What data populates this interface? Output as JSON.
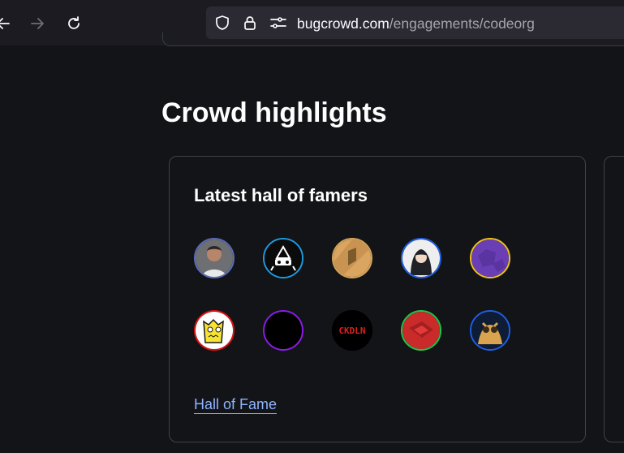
{
  "browser": {
    "url_domain": "bugcrowd.com",
    "url_path": "/engagements/codeorg",
    "icons": [
      "back-arrow-icon",
      "forward-arrow-icon",
      "reload-icon",
      "shield-icon",
      "lock-icon",
      "permissions-icon"
    ]
  },
  "section": {
    "title": "Crowd highlights"
  },
  "hall_of_fame_card": {
    "title": "Latest hall of famers",
    "link_label": "Hall of Fame",
    "avatars": [
      {
        "name": "avatar-1",
        "ring_color": "#5b6bb8"
      },
      {
        "name": "avatar-2",
        "ring_color": "#1e9be0"
      },
      {
        "name": "avatar-3",
        "ring_color": "#d4a35a"
      },
      {
        "name": "avatar-4",
        "ring_color": "#1f5fe0"
      },
      {
        "name": "avatar-5",
        "ring_color": "#f0c419"
      },
      {
        "name": "avatar-6",
        "ring_color": "#e01010"
      },
      {
        "name": "avatar-7",
        "ring_color": "#8a1be6"
      },
      {
        "name": "avatar-8",
        "ring_color": "#000000",
        "text": "CKDLN"
      },
      {
        "name": "avatar-9",
        "ring_color": "#18c94a"
      },
      {
        "name": "avatar-10",
        "ring_color": "#1f5fe0"
      }
    ]
  },
  "colors": {
    "background": "#121417",
    "toolbar": "#1c1b22",
    "link": "#8fb4ff"
  }
}
